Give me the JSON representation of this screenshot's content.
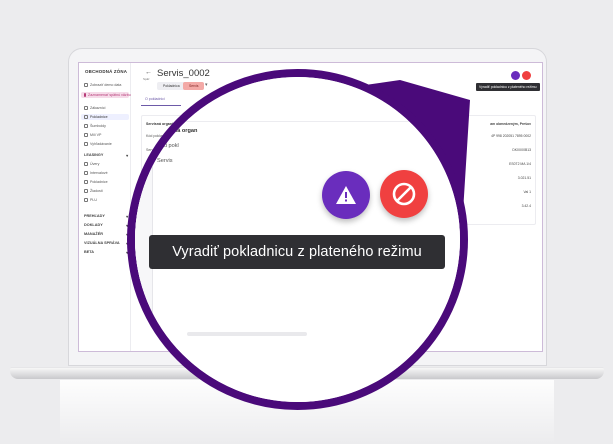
{
  "sidebar": {
    "title": "OBCHODNÁ ZÓNA",
    "items": [
      {
        "label": "Zobraziť demo data"
      },
      {
        "label": "Zaznamenať spätnú väzbu"
      },
      {
        "label": "Zákazníci"
      },
      {
        "label": "Pokladnice"
      },
      {
        "label": "Šumboldy"
      },
      {
        "label": "Milí VP"
      },
      {
        "label": "Vyhľadávanie"
      }
    ],
    "groups": [
      {
        "label": "LEASINGY"
      },
      {
        "label": "PREHĽADY"
      },
      {
        "label": "DOKLADY"
      },
      {
        "label": "MANAŽÉR"
      },
      {
        "label": "VIZUÁLNA SPRÁVA"
      },
      {
        "label": "BETA"
      }
    ],
    "sub_items": [
      {
        "label": "Úvery"
      },
      {
        "label": "Intervalové"
      },
      {
        "label": "Pokladnice"
      },
      {
        "label": "Žiadosti"
      },
      {
        "label": "PLU"
      }
    ]
  },
  "header": {
    "title": "Servis_0002",
    "back_sub": "Späť",
    "pill_a": "Pokladnica",
    "pill_b": "Servis",
    "tab": "O pokladnici"
  },
  "card": {
    "head_left": "Servisná organizácia",
    "head_right": "am obmedzeným, Prešov",
    "row1_left": "Kód pokladnice",
    "row2_left": "Servis",
    "values": [
      "4P 998 202051 7895 0002",
      "DK0X00B13",
      "ES0T2 MA 1/4",
      "3.021.51",
      "Val 1",
      "3.42.4"
    ]
  },
  "mini_tooltip": "Vyradiť pokladnicu z plateného režimu",
  "magnified": {
    "tab": "O pokladnici",
    "card_head": "Servisná organ",
    "row1": "Kód pokl",
    "row2": "Servis",
    "tooltip": "Vyradiť pokladnicu z plateného režimu"
  },
  "colors": {
    "accent_purple": "#6a2dbd",
    "ring_purple": "#4a0a7a",
    "danger_red": "#f04040",
    "tooltip_bg": "#2f2f33"
  },
  "icons": {
    "warn": "warning-triangle-icon",
    "ban": "ban-icon"
  }
}
